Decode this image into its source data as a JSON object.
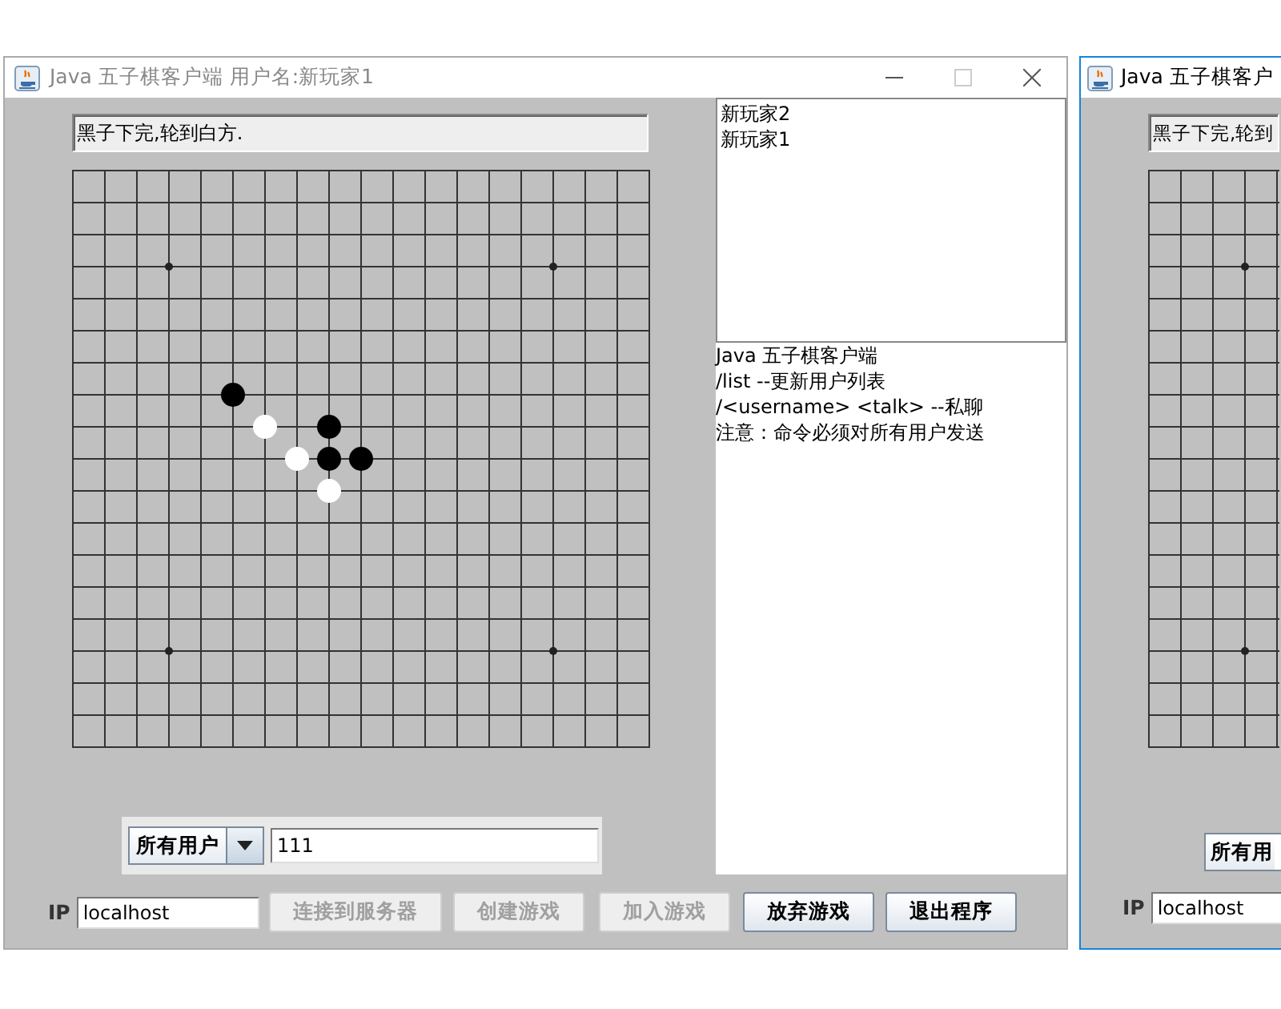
{
  "main_window": {
    "title": "Java 五子棋客户端 用户名:新玩家1",
    "focused": false,
    "status": "黑子下完,轮到白方.",
    "board": {
      "rows": [
        {
          "cells": [
            {
              "kind": "empty"
            },
            {
              "kind": "empty"
            },
            {
              "kind": "empty"
            },
            {
              "kind": "empty"
            },
            {
              "kind": "empty"
            },
            {
              "kind": "empty"
            },
            {
              "kind": "empty"
            },
            {
              "kind": "empty"
            },
            {
              "kind": "empty"
            },
            {
              "kind": "empty"
            },
            {
              "kind": "empty"
            },
            {
              "kind": "empty"
            },
            {
              "kind": "empty"
            },
            {
              "kind": "empty"
            },
            {
              "kind": "empty"
            },
            {
              "kind": "empty"
            },
            {
              "kind": "empty"
            },
            {
              "kind": "empty"
            },
            {
              "kind": "empty"
            }
          ]
        },
        {
          "cells": [
            {
              "kind": "empty"
            },
            {
              "kind": "empty"
            },
            {
              "kind": "empty"
            },
            {
              "kind": "empty"
            },
            {
              "kind": "empty"
            },
            {
              "kind": "empty"
            },
            {
              "kind": "empty"
            },
            {
              "kind": "empty"
            },
            {
              "kind": "empty"
            },
            {
              "kind": "empty"
            },
            {
              "kind": "empty"
            },
            {
              "kind": "empty"
            },
            {
              "kind": "empty"
            },
            {
              "kind": "empty"
            },
            {
              "kind": "empty"
            },
            {
              "kind": "empty"
            },
            {
              "kind": "empty"
            },
            {
              "kind": "empty"
            },
            {
              "kind": "empty"
            }
          ]
        },
        {
          "cells": [
            {
              "kind": "empty"
            },
            {
              "kind": "empty"
            },
            {
              "kind": "empty"
            },
            {
              "kind": "empty"
            },
            {
              "kind": "empty"
            },
            {
              "kind": "empty"
            },
            {
              "kind": "empty"
            },
            {
              "kind": "empty"
            },
            {
              "kind": "empty"
            },
            {
              "kind": "empty"
            },
            {
              "kind": "empty"
            },
            {
              "kind": "empty"
            },
            {
              "kind": "empty"
            },
            {
              "kind": "empty"
            },
            {
              "kind": "empty"
            },
            {
              "kind": "empty"
            },
            {
              "kind": "empty"
            },
            {
              "kind": "empty"
            },
            {
              "kind": "empty"
            }
          ]
        },
        {
          "cells": [
            {
              "kind": "empty"
            },
            {
              "kind": "empty"
            },
            {
              "kind": "empty"
            },
            {
              "kind": "empty"
            },
            {
              "kind": "empty"
            },
            {
              "kind": "empty"
            },
            {
              "kind": "empty"
            },
            {
              "kind": "empty"
            },
            {
              "kind": "empty"
            },
            {
              "kind": "empty"
            },
            {
              "kind": "empty"
            },
            {
              "kind": "empty"
            },
            {
              "kind": "empty"
            },
            {
              "kind": "empty"
            },
            {
              "kind": "empty"
            },
            {
              "kind": "empty"
            },
            {
              "kind": "empty"
            },
            {
              "kind": "empty"
            },
            {
              "kind": "empty"
            }
          ]
        },
        {
          "cells": [
            {
              "kind": "empty"
            },
            {
              "kind": "empty"
            },
            {
              "kind": "empty"
            },
            {
              "kind": "empty"
            },
            {
              "kind": "empty"
            },
            {
              "kind": "empty"
            },
            {
              "kind": "empty"
            },
            {
              "kind": "empty"
            },
            {
              "kind": "empty"
            },
            {
              "kind": "empty"
            },
            {
              "kind": "empty"
            },
            {
              "kind": "empty"
            },
            {
              "kind": "empty"
            },
            {
              "kind": "empty"
            },
            {
              "kind": "empty"
            },
            {
              "kind": "empty"
            },
            {
              "kind": "empty"
            },
            {
              "kind": "empty"
            },
            {
              "kind": "empty"
            }
          ]
        },
        {
          "cells": [
            {
              "kind": "empty"
            },
            {
              "kind": "empty"
            },
            {
              "kind": "empty"
            },
            {
              "kind": "empty"
            },
            {
              "kind": "empty"
            },
            {
              "kind": "empty"
            },
            {
              "kind": "empty"
            },
            {
              "kind": "empty"
            },
            {
              "kind": "empty"
            },
            {
              "kind": "empty"
            },
            {
              "kind": "empty"
            },
            {
              "kind": "empty"
            },
            {
              "kind": "empty"
            },
            {
              "kind": "empty"
            },
            {
              "kind": "empty"
            },
            {
              "kind": "empty"
            },
            {
              "kind": "empty"
            },
            {
              "kind": "empty"
            },
            {
              "kind": "empty"
            }
          ]
        },
        {
          "cells": [
            {
              "kind": "empty"
            },
            {
              "kind": "empty"
            },
            {
              "kind": "empty"
            },
            {
              "kind": "empty"
            },
            {
              "kind": "empty"
            },
            {
              "kind": "empty"
            },
            {
              "kind": "empty"
            },
            {
              "kind": "empty"
            },
            {
              "kind": "empty"
            },
            {
              "kind": "empty"
            },
            {
              "kind": "empty"
            },
            {
              "kind": "empty"
            },
            {
              "kind": "empty"
            },
            {
              "kind": "empty"
            },
            {
              "kind": "empty"
            },
            {
              "kind": "empty"
            },
            {
              "kind": "empty"
            },
            {
              "kind": "empty"
            },
            {
              "kind": "empty"
            }
          ]
        },
        {
          "cells": [
            {
              "kind": "empty"
            },
            {
              "kind": "empty"
            },
            {
              "kind": "empty"
            },
            {
              "kind": "empty"
            },
            {
              "kind": "empty"
            },
            {
              "kind": "black"
            },
            {
              "kind": "empty"
            },
            {
              "kind": "empty"
            },
            {
              "kind": "empty"
            },
            {
              "kind": "empty"
            },
            {
              "kind": "empty"
            },
            {
              "kind": "empty"
            },
            {
              "kind": "empty"
            },
            {
              "kind": "empty"
            },
            {
              "kind": "empty"
            },
            {
              "kind": "empty"
            },
            {
              "kind": "empty"
            },
            {
              "kind": "empty"
            },
            {
              "kind": "empty"
            }
          ]
        },
        {
          "cells": [
            {
              "kind": "empty"
            },
            {
              "kind": "empty"
            },
            {
              "kind": "empty"
            },
            {
              "kind": "empty"
            },
            {
              "kind": "empty"
            },
            {
              "kind": "empty"
            },
            {
              "kind": "white"
            },
            {
              "kind": "empty"
            },
            {
              "kind": "black"
            },
            {
              "kind": "empty"
            },
            {
              "kind": "empty"
            },
            {
              "kind": "empty"
            },
            {
              "kind": "empty"
            },
            {
              "kind": "empty"
            },
            {
              "kind": "empty"
            },
            {
              "kind": "empty"
            },
            {
              "kind": "empty"
            },
            {
              "kind": "empty"
            },
            {
              "kind": "empty"
            }
          ]
        },
        {
          "cells": [
            {
              "kind": "empty"
            },
            {
              "kind": "empty"
            },
            {
              "kind": "empty"
            },
            {
              "kind": "empty"
            },
            {
              "kind": "empty"
            },
            {
              "kind": "empty"
            },
            {
              "kind": "empty"
            },
            {
              "kind": "white"
            },
            {
              "kind": "black"
            },
            {
              "kind": "black"
            },
            {
              "kind": "empty"
            },
            {
              "kind": "empty"
            },
            {
              "kind": "empty"
            },
            {
              "kind": "empty"
            },
            {
              "kind": "empty"
            },
            {
              "kind": "empty"
            },
            {
              "kind": "empty"
            },
            {
              "kind": "empty"
            },
            {
              "kind": "empty"
            }
          ]
        },
        {
          "cells": [
            {
              "kind": "empty"
            },
            {
              "kind": "empty"
            },
            {
              "kind": "empty"
            },
            {
              "kind": "empty"
            },
            {
              "kind": "empty"
            },
            {
              "kind": "empty"
            },
            {
              "kind": "empty"
            },
            {
              "kind": "empty"
            },
            {
              "kind": "white"
            },
            {
              "kind": "empty"
            },
            {
              "kind": "empty"
            },
            {
              "kind": "empty"
            },
            {
              "kind": "empty"
            },
            {
              "kind": "empty"
            },
            {
              "kind": "empty"
            },
            {
              "kind": "empty"
            },
            {
              "kind": "empty"
            },
            {
              "kind": "empty"
            },
            {
              "kind": "empty"
            }
          ]
        },
        {
          "cells": [
            {
              "kind": "empty"
            },
            {
              "kind": "empty"
            },
            {
              "kind": "empty"
            },
            {
              "kind": "empty"
            },
            {
              "kind": "empty"
            },
            {
              "kind": "empty"
            },
            {
              "kind": "empty"
            },
            {
              "kind": "empty"
            },
            {
              "kind": "empty"
            },
            {
              "kind": "empty"
            },
            {
              "kind": "empty"
            },
            {
              "kind": "empty"
            },
            {
              "kind": "empty"
            },
            {
              "kind": "empty"
            },
            {
              "kind": "empty"
            },
            {
              "kind": "empty"
            },
            {
              "kind": "empty"
            },
            {
              "kind": "empty"
            },
            {
              "kind": "empty"
            }
          ]
        },
        {
          "cells": [
            {
              "kind": "empty"
            },
            {
              "kind": "empty"
            },
            {
              "kind": "empty"
            },
            {
              "kind": "empty"
            },
            {
              "kind": "empty"
            },
            {
              "kind": "empty"
            },
            {
              "kind": "empty"
            },
            {
              "kind": "empty"
            },
            {
              "kind": "empty"
            },
            {
              "kind": "empty"
            },
            {
              "kind": "empty"
            },
            {
              "kind": "empty"
            },
            {
              "kind": "empty"
            },
            {
              "kind": "empty"
            },
            {
              "kind": "empty"
            },
            {
              "kind": "empty"
            },
            {
              "kind": "empty"
            },
            {
              "kind": "empty"
            },
            {
              "kind": "empty"
            }
          ]
        },
        {
          "cells": [
            {
              "kind": "empty"
            },
            {
              "kind": "empty"
            },
            {
              "kind": "empty"
            },
            {
              "kind": "empty"
            },
            {
              "kind": "empty"
            },
            {
              "kind": "empty"
            },
            {
              "kind": "empty"
            },
            {
              "kind": "empty"
            },
            {
              "kind": "empty"
            },
            {
              "kind": "empty"
            },
            {
              "kind": "empty"
            },
            {
              "kind": "empty"
            },
            {
              "kind": "empty"
            },
            {
              "kind": "empty"
            },
            {
              "kind": "empty"
            },
            {
              "kind": "empty"
            },
            {
              "kind": "empty"
            },
            {
              "kind": "empty"
            },
            {
              "kind": "empty"
            }
          ]
        },
        {
          "cells": [
            {
              "kind": "empty"
            },
            {
              "kind": "empty"
            },
            {
              "kind": "empty"
            },
            {
              "kind": "empty"
            },
            {
              "kind": "empty"
            },
            {
              "kind": "empty"
            },
            {
              "kind": "empty"
            },
            {
              "kind": "empty"
            },
            {
              "kind": "empty"
            },
            {
              "kind": "empty"
            },
            {
              "kind": "empty"
            },
            {
              "kind": "empty"
            },
            {
              "kind": "empty"
            },
            {
              "kind": "empty"
            },
            {
              "kind": "empty"
            },
            {
              "kind": "empty"
            },
            {
              "kind": "empty"
            },
            {
              "kind": "empty"
            },
            {
              "kind": "empty"
            }
          ]
        },
        {
          "cells": [
            {
              "kind": "empty"
            },
            {
              "kind": "empty"
            },
            {
              "kind": "empty"
            },
            {
              "kind": "empty"
            },
            {
              "kind": "empty"
            },
            {
              "kind": "empty"
            },
            {
              "kind": "empty"
            },
            {
              "kind": "empty"
            },
            {
              "kind": "empty"
            },
            {
              "kind": "empty"
            },
            {
              "kind": "empty"
            },
            {
              "kind": "empty"
            },
            {
              "kind": "empty"
            },
            {
              "kind": "empty"
            },
            {
              "kind": "empty"
            },
            {
              "kind": "empty"
            },
            {
              "kind": "empty"
            },
            {
              "kind": "empty"
            },
            {
              "kind": "empty"
            }
          ]
        },
        {
          "cells": [
            {
              "kind": "empty"
            },
            {
              "kind": "empty"
            },
            {
              "kind": "empty"
            },
            {
              "kind": "empty"
            },
            {
              "kind": "empty"
            },
            {
              "kind": "empty"
            },
            {
              "kind": "empty"
            },
            {
              "kind": "empty"
            },
            {
              "kind": "empty"
            },
            {
              "kind": "empty"
            },
            {
              "kind": "empty"
            },
            {
              "kind": "empty"
            },
            {
              "kind": "empty"
            },
            {
              "kind": "empty"
            },
            {
              "kind": "empty"
            },
            {
              "kind": "empty"
            },
            {
              "kind": "empty"
            },
            {
              "kind": "empty"
            },
            {
              "kind": "empty"
            }
          ]
        },
        {
          "cells": [
            {
              "kind": "empty"
            },
            {
              "kind": "empty"
            },
            {
              "kind": "empty"
            },
            {
              "kind": "empty"
            },
            {
              "kind": "empty"
            },
            {
              "kind": "empty"
            },
            {
              "kind": "empty"
            },
            {
              "kind": "empty"
            },
            {
              "kind": "empty"
            },
            {
              "kind": "empty"
            },
            {
              "kind": "empty"
            },
            {
              "kind": "empty"
            },
            {
              "kind": "empty"
            },
            {
              "kind": "empty"
            },
            {
              "kind": "empty"
            },
            {
              "kind": "empty"
            },
            {
              "kind": "empty"
            },
            {
              "kind": "empty"
            },
            {
              "kind": "empty"
            }
          ]
        },
        {
          "cells": [
            {
              "kind": "empty"
            },
            {
              "kind": "empty"
            },
            {
              "kind": "empty"
            },
            {
              "kind": "empty"
            },
            {
              "kind": "empty"
            },
            {
              "kind": "empty"
            },
            {
              "kind": "empty"
            },
            {
              "kind": "empty"
            },
            {
              "kind": "empty"
            },
            {
              "kind": "empty"
            },
            {
              "kind": "empty"
            },
            {
              "kind": "empty"
            },
            {
              "kind": "empty"
            },
            {
              "kind": "empty"
            },
            {
              "kind": "empty"
            },
            {
              "kind": "empty"
            },
            {
              "kind": "empty"
            },
            {
              "kind": "empty"
            },
            {
              "kind": "empty"
            }
          ]
        }
      ]
    },
    "users": [
      "新玩家2",
      "新玩家1"
    ],
    "messages": [
      "Java 五子棋客户端",
      "/list --更新用户列表",
      "/<username> <talk> --私聊",
      "注意：命令必须对所有用户发送"
    ],
    "recipient": "所有用户",
    "message_input": "111",
    "ip_label": "IP",
    "ip_field": "localhost",
    "buttons": [
      {
        "label": "连接到服务器",
        "disabled": true
      },
      {
        "label": "创建游戏",
        "disabled": true
      },
      {
        "label": "加入游戏",
        "disabled": true
      },
      {
        "label": "放弃游戏",
        "disabled": false
      },
      {
        "label": "退出程序",
        "disabled": false
      }
    ]
  },
  "second_window": {
    "title": "Java 五子棋客户",
    "focused": true,
    "status": "黑子下完,轮到",
    "recipient": "所有用",
    "ip_label": "IP",
    "ip_field": "localhost"
  }
}
